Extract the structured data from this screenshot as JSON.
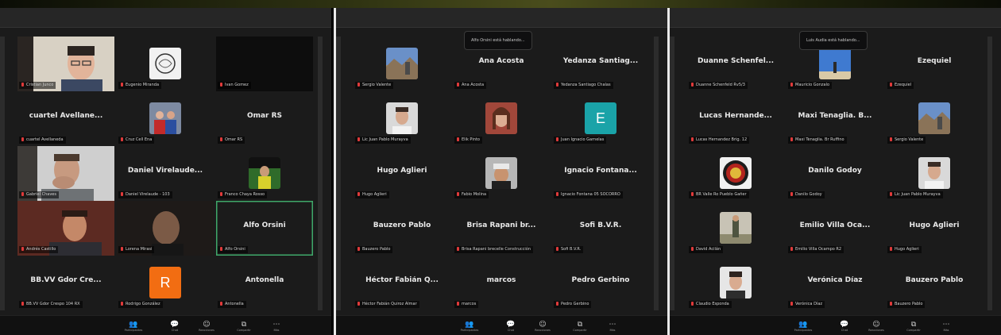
{
  "panels": [
    {
      "toast": "",
      "tiles": [
        {
          "label": "Cristian Junco",
          "kind": "video",
          "scene": "face-glasses"
        },
        {
          "label": "Eugenio Miranda",
          "kind": "avatar",
          "scene": "sketch"
        },
        {
          "label": "Ivan Gomez",
          "kind": "video",
          "scene": "dark"
        },
        {
          "name": "cuartel Avellane...",
          "label": "cuartel Avellaneda",
          "kind": "name"
        },
        {
          "label": "Cruz Cell Ena",
          "kind": "avatar",
          "scene": "group"
        },
        {
          "name": "Omar RS",
          "label": "Omar RS",
          "kind": "name"
        },
        {
          "label": "Gabriel Chaves",
          "kind": "video",
          "scene": "face-hand"
        },
        {
          "name": "Daniel Virelaude...",
          "label": "Daniel Virelaude - 103",
          "kind": "name"
        },
        {
          "label": "Franco Chaya Rosso",
          "kind": "avatar",
          "scene": "outdoor"
        },
        {
          "label": "Andrés Castillo",
          "kind": "video",
          "scene": "face-red"
        },
        {
          "label": "Lorena Mirasi",
          "kind": "video",
          "scene": "face-dark"
        },
        {
          "name": "Alfo Orsini",
          "label": "Alfo Orsini",
          "kind": "name",
          "active": true
        },
        {
          "name": "BB.VV Gdor Cre...",
          "label": "BB.VV Gdor Crespo 104 RX",
          "kind": "name"
        },
        {
          "label": "Rodrigo González",
          "kind": "letter",
          "letter": "R",
          "color": "#f26d12"
        },
        {
          "name": "Antonella",
          "label": "Antonella",
          "kind": "name"
        }
      ]
    },
    {
      "toast": "Alfo Orsini está hablando...",
      "tiles": [
        {
          "label": "Sergio Valente",
          "kind": "avatar",
          "scene": "landscape"
        },
        {
          "name": "Ana Acosta",
          "label": "Ana Acosta",
          "kind": "name"
        },
        {
          "name": "Yedanza Santiag...",
          "label": "Yedanza Santiago Chalas",
          "kind": "name"
        },
        {
          "label": "Lic Juan Pablo Murayva",
          "kind": "avatar",
          "scene": "portrait-male"
        },
        {
          "label": "Elik Pinto",
          "kind": "avatar",
          "scene": "portrait-female"
        },
        {
          "label": "Juan Ignacio Garnelas",
          "kind": "letter",
          "letter": "E",
          "color": "#1aa3a8"
        },
        {
          "name": "Hugo Aglieri",
          "label": "Hugo Aglieri",
          "kind": "name"
        },
        {
          "label": "Fabio Molina",
          "kind": "avatar",
          "scene": "portrait-cap"
        },
        {
          "name": "Ignacio Fontana...",
          "label": "Ignacio Fontana 05 SOCORRO",
          "kind": "name"
        },
        {
          "name": "Bauzero Pablo",
          "label": "Bauzero Pablo",
          "kind": "name"
        },
        {
          "name": "Brisa Rapani br...",
          "label": "Brisa Rapani brecelle Construcción",
          "kind": "name"
        },
        {
          "name": "Sofi B.V.R.",
          "label": "Sofi B.V.R.",
          "kind": "name"
        },
        {
          "name": "Héctor Fabián Q...",
          "label": "Héctor Fabián Quiroz Almar",
          "kind": "name"
        },
        {
          "name": "marcos",
          "label": "marcos",
          "kind": "name"
        },
        {
          "name": "Pedro Gerbino",
          "label": "Pedro Gerbino",
          "kind": "name"
        }
      ]
    },
    {
      "toast": "Luis Audia está hablando...",
      "tiles": [
        {
          "name": "Duanne Schenfel...",
          "label": "Duanne Schenfeld Rv5/3",
          "kind": "name"
        },
        {
          "label": "Mauricio Gonzalo",
          "kind": "avatar",
          "scene": "sky"
        },
        {
          "name": "Ezequiel",
          "label": "Ezequiel",
          "kind": "name"
        },
        {
          "name": "Lucas Hernande...",
          "label": "Lucas Hernandez Brig. 12",
          "kind": "name"
        },
        {
          "name": "Maxi Tenaglia. B...",
          "label": "Maxi Tenaglia. Br Ruffino",
          "kind": "name"
        },
        {
          "label": "Sergio Valente",
          "kind": "avatar",
          "scene": "landscape"
        },
        {
          "label": "BR Valle Ro Pueblo Gañer",
          "kind": "avatar",
          "scene": "emblem"
        },
        {
          "name": "Danilo Godoy",
          "label": "Danilo Godoy",
          "kind": "name"
        },
        {
          "label": "Lic Juan Pablo Murayva",
          "kind": "avatar",
          "scene": "portrait-male"
        },
        {
          "label": "David Acilán",
          "kind": "avatar",
          "scene": "standing"
        },
        {
          "name": "Emilio Villa Oca...",
          "label": "Emilio Villa Ocampo R2",
          "kind": "name"
        },
        {
          "name": "Hugo Aglieri",
          "label": "Hugo Aglieri",
          "kind": "name"
        },
        {
          "label": "Claudio Esponda",
          "kind": "avatar",
          "scene": "portrait-young"
        },
        {
          "name": "Verónica Díaz",
          "label": "Verónica Díaz",
          "kind": "name"
        },
        {
          "name": "Bauzero Pablo",
          "label": "Bauzero Pablo",
          "kind": "name"
        }
      ]
    }
  ],
  "toolbar": [
    {
      "icon": "participants-icon",
      "glyph": "👥",
      "label": "Participantes"
    },
    {
      "icon": "chat-icon",
      "glyph": "💬",
      "label": "Chat"
    },
    {
      "icon": "reactions-icon",
      "glyph": "☺",
      "label": "Reacciones"
    },
    {
      "icon": "share-screen-icon",
      "glyph": "⧉",
      "label": "Compartir"
    },
    {
      "icon": "more-icon",
      "glyph": "⋯",
      "label": "Más"
    }
  ],
  "colors": {
    "active_border": "#3fa86a",
    "muted_mic": "#e03a3a",
    "tile_bg": "#1b1b1b",
    "toolbar_bg": "#111111"
  }
}
